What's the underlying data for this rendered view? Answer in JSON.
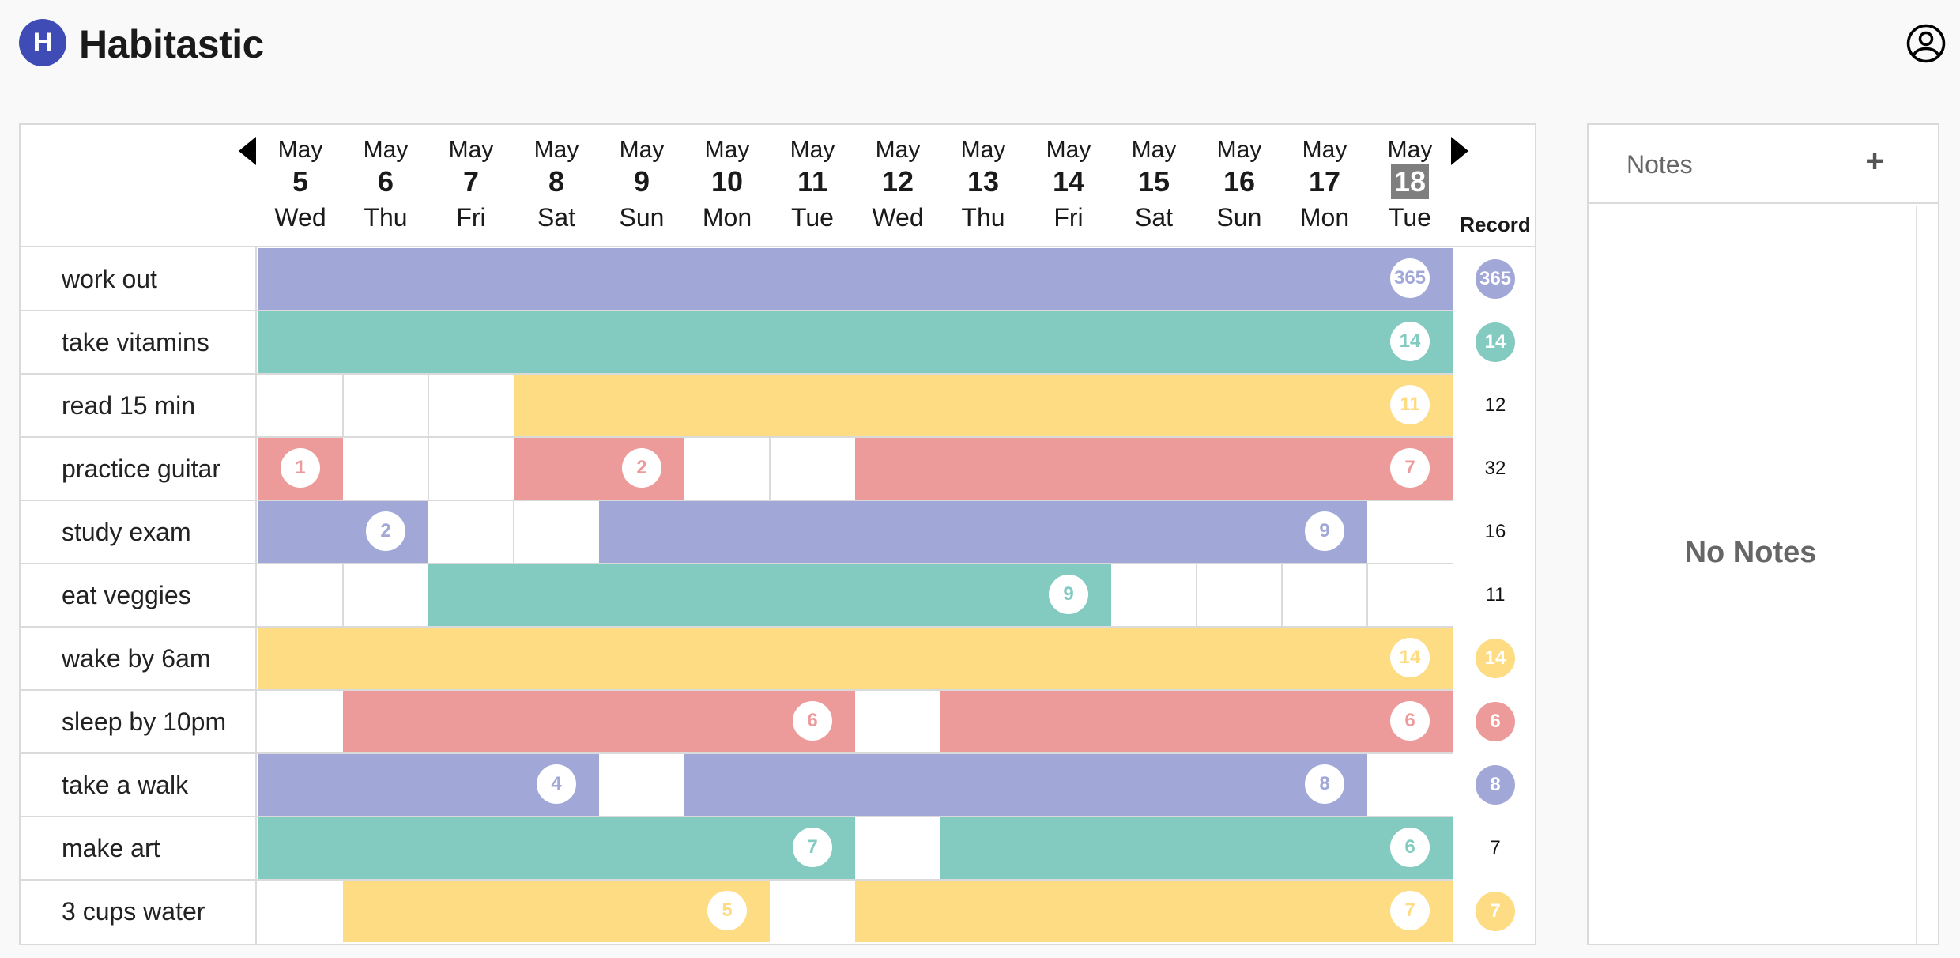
{
  "app": {
    "logo_letter": "H",
    "title": "Habitastic"
  },
  "colors": {
    "purple": "#a1a8d8",
    "teal": "#83cbc1",
    "yellow": "#fddc83",
    "pink": "#ed9a9a",
    "brand": "#3f4cb5"
  },
  "icons": {
    "account": "account-circle-icon",
    "prev": "caret-left-icon",
    "next": "caret-right-icon",
    "add": "plus-icon"
  },
  "dates": [
    {
      "month": "May",
      "day": "5",
      "dow": "Wed"
    },
    {
      "month": "May",
      "day": "6",
      "dow": "Thu"
    },
    {
      "month": "May",
      "day": "7",
      "dow": "Fri"
    },
    {
      "month": "May",
      "day": "8",
      "dow": "Sat"
    },
    {
      "month": "May",
      "day": "9",
      "dow": "Sun"
    },
    {
      "month": "May",
      "day": "10",
      "dow": "Mon"
    },
    {
      "month": "May",
      "day": "11",
      "dow": "Tue"
    },
    {
      "month": "May",
      "day": "12",
      "dow": "Wed"
    },
    {
      "month": "May",
      "day": "13",
      "dow": "Thu"
    },
    {
      "month": "May",
      "day": "14",
      "dow": "Fri"
    },
    {
      "month": "May",
      "day": "15",
      "dow": "Sat"
    },
    {
      "month": "May",
      "day": "16",
      "dow": "Sun"
    },
    {
      "month": "May",
      "day": "17",
      "dow": "Mon"
    },
    {
      "month": "May",
      "day": "18",
      "dow": "Tue",
      "today": true
    }
  ],
  "record_header": "Record",
  "habits": [
    {
      "name": "work out",
      "color": "purple",
      "done": [
        1,
        1,
        1,
        1,
        1,
        1,
        1,
        1,
        1,
        1,
        1,
        1,
        1,
        1
      ],
      "streaks": [
        "",
        "",
        "",
        "",
        "",
        "",
        "",
        "",
        "",
        "",
        "",
        "",
        "",
        "365"
      ],
      "record": "365",
      "record_highlight": true
    },
    {
      "name": "take vitamins",
      "color": "teal",
      "done": [
        1,
        1,
        1,
        1,
        1,
        1,
        1,
        1,
        1,
        1,
        1,
        1,
        1,
        1
      ],
      "streaks": [
        "",
        "",
        "",
        "",
        "",
        "",
        "",
        "",
        "",
        "",
        "",
        "",
        "",
        "14"
      ],
      "record": "14",
      "record_highlight": true
    },
    {
      "name": "read 15 min",
      "color": "yellow",
      "done": [
        0,
        0,
        0,
        1,
        1,
        1,
        1,
        1,
        1,
        1,
        1,
        1,
        1,
        1
      ],
      "streaks": [
        "",
        "",
        "",
        "",
        "",
        "",
        "",
        "",
        "",
        "",
        "",
        "",
        "",
        "11"
      ],
      "record": "12",
      "record_highlight": false
    },
    {
      "name": "practice guitar",
      "color": "pink",
      "done": [
        1,
        0,
        0,
        1,
        1,
        0,
        0,
        1,
        1,
        1,
        1,
        1,
        1,
        1
      ],
      "streaks": [
        "1",
        "",
        "",
        "",
        "2",
        "",
        "",
        "",
        "",
        "",
        "",
        "",
        "",
        "7"
      ],
      "record": "32",
      "record_highlight": false
    },
    {
      "name": "study exam",
      "color": "purple",
      "done": [
        1,
        1,
        0,
        0,
        1,
        1,
        1,
        1,
        1,
        1,
        1,
        1,
        1,
        0
      ],
      "streaks": [
        "",
        "2",
        "",
        "",
        "",
        "",
        "",
        "",
        "",
        "",
        "",
        "",
        "9",
        ""
      ],
      "record": "16",
      "record_highlight": false
    },
    {
      "name": "eat veggies",
      "color": "teal",
      "done": [
        0,
        0,
        1,
        1,
        1,
        1,
        1,
        1,
        1,
        1,
        0,
        0,
        0,
        0
      ],
      "streaks": [
        "",
        "",
        "",
        "",
        "",
        "",
        "",
        "",
        "",
        "9",
        "",
        "",
        "",
        ""
      ],
      "record": "11",
      "record_highlight": false
    },
    {
      "name": "wake by 6am",
      "color": "yellow",
      "done": [
        1,
        1,
        1,
        1,
        1,
        1,
        1,
        1,
        1,
        1,
        1,
        1,
        1,
        1
      ],
      "streaks": [
        "",
        "",
        "",
        "",
        "",
        "",
        "",
        "",
        "",
        "",
        "",
        "",
        "",
        "14"
      ],
      "record": "14",
      "record_highlight": true
    },
    {
      "name": "sleep by 10pm",
      "color": "pink",
      "done": [
        0,
        1,
        1,
        1,
        1,
        1,
        1,
        0,
        1,
        1,
        1,
        1,
        1,
        1
      ],
      "streaks": [
        "",
        "",
        "",
        "",
        "",
        "",
        "6",
        "",
        "",
        "",
        "",
        "",
        "",
        "6"
      ],
      "record": "6",
      "record_highlight": true
    },
    {
      "name": "take a walk",
      "color": "purple",
      "done": [
        1,
        1,
        1,
        1,
        0,
        1,
        1,
        1,
        1,
        1,
        1,
        1,
        1,
        0
      ],
      "streaks": [
        "",
        "",
        "",
        "4",
        "",
        "",
        "",
        "",
        "",
        "",
        "",
        "",
        "8",
        ""
      ],
      "record": "8",
      "record_highlight": true
    },
    {
      "name": "make art",
      "color": "teal",
      "done": [
        1,
        1,
        1,
        1,
        1,
        1,
        1,
        0,
        1,
        1,
        1,
        1,
        1,
        1
      ],
      "streaks": [
        "",
        "",
        "",
        "",
        "",
        "",
        "7",
        "",
        "",
        "",
        "",
        "",
        "",
        "6"
      ],
      "record": "7",
      "record_highlight": false
    },
    {
      "name": "3 cups water",
      "color": "yellow",
      "done": [
        0,
        1,
        1,
        1,
        1,
        1,
        0,
        1,
        1,
        1,
        1,
        1,
        1,
        1
      ],
      "streaks": [
        "",
        "",
        "",
        "",
        "",
        "5",
        "",
        "",
        "",
        "",
        "",
        "",
        "",
        "7"
      ],
      "record": "7",
      "record_highlight": true
    }
  ],
  "notes": {
    "title": "Notes",
    "add_label": "+",
    "empty_text": "No Notes"
  }
}
